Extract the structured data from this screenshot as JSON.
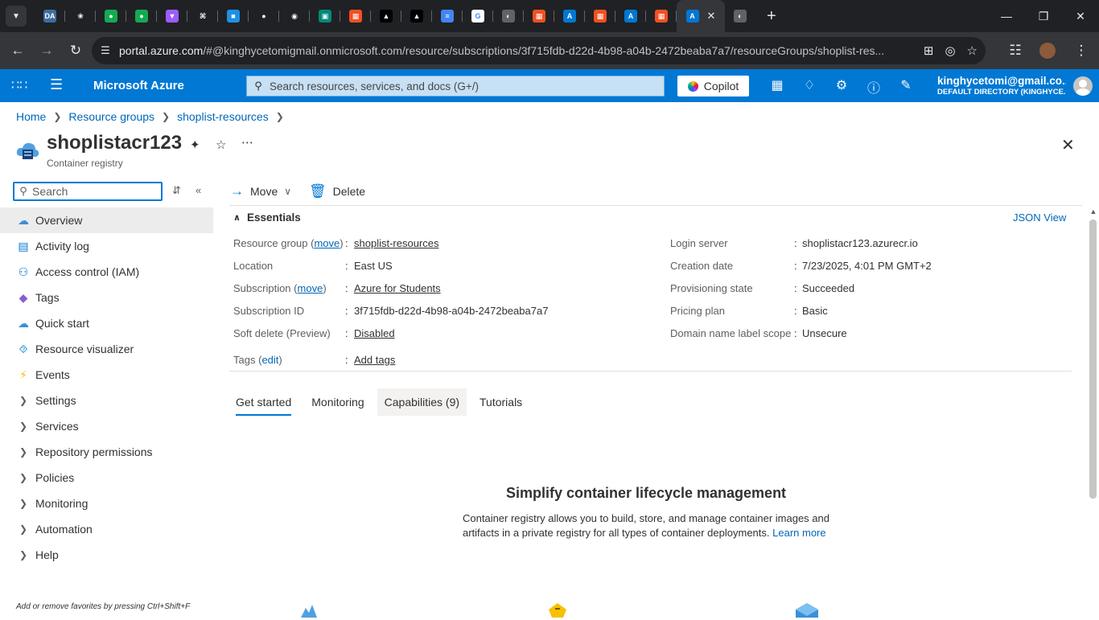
{
  "browser": {
    "tabs": [
      {
        "icon": "profile-da-icon",
        "color": "#3c6e9f",
        "glyph": "DA"
      },
      {
        "icon": "openai-icon",
        "color": "#202124",
        "glyph": "❀"
      },
      {
        "icon": "mongodb-icon",
        "color": "#13aa52",
        "glyph": "●"
      },
      {
        "icon": "mongodb-icon",
        "color": "#13aa52",
        "glyph": "●"
      },
      {
        "icon": "vite-icon",
        "color": "#9d5cff",
        "glyph": "▼"
      },
      {
        "icon": "hashnode-icon",
        "color": "#202124",
        "glyph": "⌘"
      },
      {
        "icon": "docker-icon",
        "color": "#1d91e6",
        "glyph": "■"
      },
      {
        "icon": "spotify-icon",
        "color": "#202124",
        "glyph": "●"
      },
      {
        "icon": "github-icon",
        "color": "#202124",
        "glyph": "◉"
      },
      {
        "icon": "google-meet-icon",
        "color": "#00897b",
        "glyph": "▣"
      },
      {
        "icon": "microsoft-icon",
        "color": "#f25022",
        "glyph": "▦"
      },
      {
        "icon": "vercel-icon",
        "color": "#000000",
        "glyph": "▲"
      },
      {
        "icon": "vercel-icon",
        "color": "#000000",
        "glyph": "▲"
      },
      {
        "icon": "google-docs-icon",
        "color": "#4285f4",
        "glyph": "≡"
      },
      {
        "icon": "google-icon",
        "color": "#ffffff",
        "glyph": "G"
      },
      {
        "icon": "globe-icon",
        "color": "#5f6368",
        "glyph": "◐"
      },
      {
        "icon": "microsoft-icon",
        "color": "#f25022",
        "glyph": "▦"
      },
      {
        "icon": "azure-icon",
        "color": "#0078d4",
        "glyph": "A"
      },
      {
        "icon": "microsoft-icon",
        "color": "#f25022",
        "glyph": "▦"
      },
      {
        "icon": "azure-icon",
        "color": "#0078d4",
        "glyph": "A"
      },
      {
        "icon": "microsoft-icon",
        "color": "#f25022",
        "glyph": "▦"
      }
    ],
    "url_host": "portal.azure.com",
    "url_rest": "/#@kinghycetomigmail.onmicrosoft.com/resource/subscriptions/3f715fdb-d22d-4b98-a04b-2472beaba7a7/resourceGroups/shoplist-res..."
  },
  "azure": {
    "brand": "Microsoft Azure",
    "search_placeholder": "Search resources, services, and docs (G+/)",
    "copilot_label": "Copilot",
    "account_email": "kinghycetomi@gmail.co...",
    "account_directory": "DEFAULT DIRECTORY (KINGHYCE..."
  },
  "breadcrumb": [
    "Home",
    "Resource groups",
    "shoplist-resources"
  ],
  "resource": {
    "name": "shoplistacr123",
    "type": "Container registry"
  },
  "nav": {
    "search_placeholder": "Search",
    "items": [
      {
        "label": "Overview",
        "icon": "overview-cloud-icon",
        "expandable": false,
        "selected": true
      },
      {
        "label": "Activity log",
        "icon": "activity-log-icon",
        "expandable": false
      },
      {
        "label": "Access control (IAM)",
        "icon": "iam-people-icon",
        "expandable": false
      },
      {
        "label": "Tags",
        "icon": "tag-icon",
        "expandable": false
      },
      {
        "label": "Quick start",
        "icon": "quick-start-cloud-icon",
        "expandable": false
      },
      {
        "label": "Resource visualizer",
        "icon": "resource-visualizer-icon",
        "expandable": false
      },
      {
        "label": "Events",
        "icon": "lightning-icon",
        "expandable": false
      },
      {
        "label": "Settings",
        "expandable": true
      },
      {
        "label": "Services",
        "expandable": true
      },
      {
        "label": "Repository permissions",
        "expandable": true
      },
      {
        "label": "Policies",
        "expandable": true
      },
      {
        "label": "Monitoring",
        "expandable": true
      },
      {
        "label": "Automation",
        "expandable": true
      },
      {
        "label": "Help",
        "expandable": true
      }
    ],
    "favorites_hint": "Add or remove favorites by pressing Ctrl+Shift+F"
  },
  "commands": {
    "move": "Move",
    "delete": "Delete"
  },
  "essentials": {
    "title": "Essentials",
    "json_view": "JSON View",
    "left": {
      "resource_group_label": "Resource group",
      "move_link": "move",
      "resource_group_value": "shoplist-resources",
      "location_label": "Location",
      "location_value": "East US",
      "subscription_label": "Subscription",
      "subscription_value": "Azure for Students",
      "subscription_id_label": "Subscription ID",
      "subscription_id_value": "3f715fdb-d22d-4b98-a04b-2472beaba7a7",
      "soft_delete_label": "Soft delete (Preview)",
      "soft_delete_value": "Disabled",
      "tags_label": "Tags",
      "tags_edit": "edit",
      "tags_value": "Add tags"
    },
    "right": {
      "login_server_label": "Login server",
      "login_server_value": "shoplistacr123.azurecr.io",
      "creation_date_label": "Creation date",
      "creation_date_value": "7/23/2025, 4:01 PM GMT+2",
      "provisioning_label": "Provisioning state",
      "provisioning_value": "Succeeded",
      "pricing_label": "Pricing plan",
      "pricing_value": "Basic",
      "domain_label": "Domain name label scope",
      "domain_value": "Unsecure"
    }
  },
  "main_tabs": [
    "Get started",
    "Monitoring",
    "Capabilities (9)",
    "Tutorials"
  ],
  "hero": {
    "title": "Simplify container lifecycle management",
    "text": "Container registry allows you to build, store, and manage container images and artifacts in a private registry for all types of container deployments.",
    "link": "Learn more"
  },
  "colors": {
    "azure_blue": "#0078d4",
    "link": "#0067b8",
    "chrome_dark": "#202124"
  }
}
